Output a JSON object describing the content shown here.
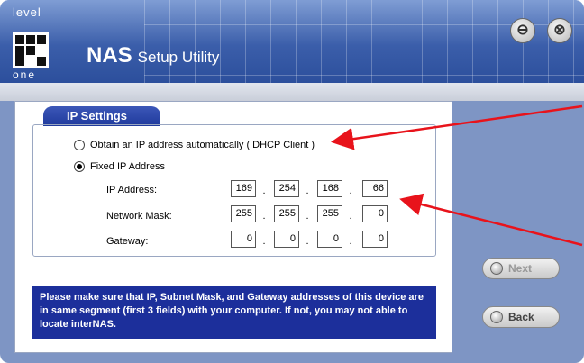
{
  "header": {
    "logo_top": "level",
    "logo_bottom": "one",
    "title_main": "NAS",
    "title_sub": "Setup Utility",
    "minimize_symbol": "⊖",
    "close_symbol": "⊗"
  },
  "tab": {
    "label": "IP Settings"
  },
  "options": {
    "dhcp_label": "Obtain an IP address automatically ( DHCP Client )",
    "fixed_label": "Fixed IP Address",
    "selected": "fixed"
  },
  "fields": {
    "ip_label": "IP Address:",
    "mask_label": "Network Mask:",
    "gateway_label": "Gateway:",
    "ip": [
      "169",
      "254",
      "168",
      "66"
    ],
    "mask": [
      "255",
      "255",
      "255",
      "0"
    ],
    "gateway": [
      "0",
      "0",
      "0",
      "0"
    ]
  },
  "notice": "Please make sure that IP, Subnet Mask, and Gateway addresses of this device are in same segment (first 3 fields) with your computer.  If not, you may not able to locate interNAS.",
  "buttons": {
    "next": "Next",
    "back": "Back"
  },
  "colors": {
    "header": "#3b5eaa",
    "notice_bg": "#1c2f9b",
    "arrow": "#e8131b",
    "panel": "#7e95c4"
  }
}
